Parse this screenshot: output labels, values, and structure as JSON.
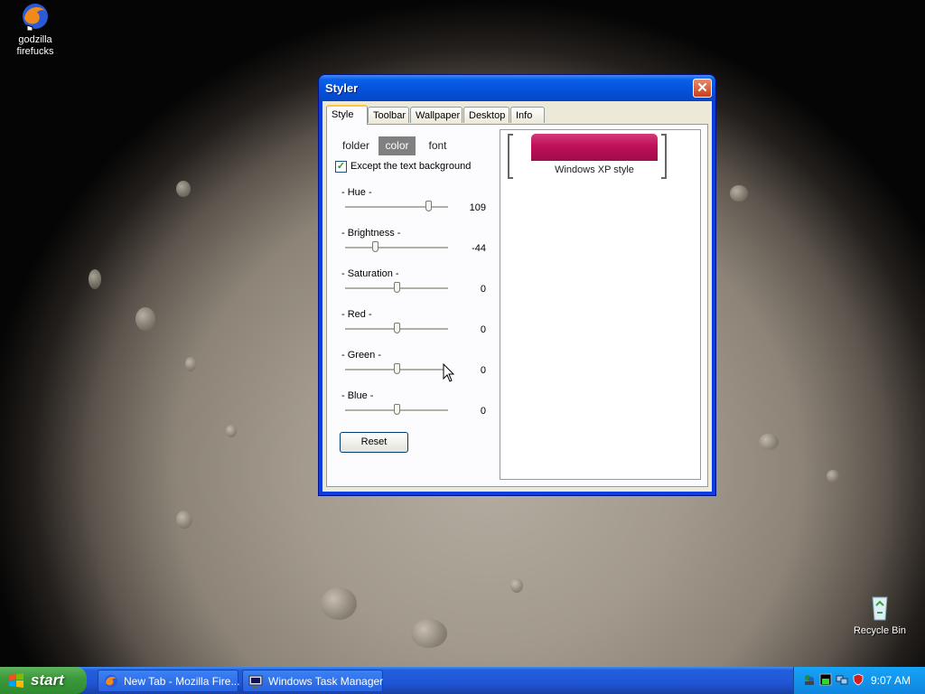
{
  "desktop": {
    "icons": [
      {
        "label": "godzilla firefucks",
        "icon": "firefox-icon"
      },
      {
        "label": "Recycle Bin",
        "icon": "recycle-bin-icon"
      }
    ]
  },
  "window": {
    "title": "Styler",
    "close_label": "✕",
    "tabs": [
      "Style",
      "Toolbar",
      "Wallpaper",
      "Desktop",
      "Info"
    ],
    "active_tab": "Style",
    "subtabs": [
      "folder",
      "color",
      "font"
    ],
    "active_subtab": "color",
    "checkbox": {
      "label": "Except the text background",
      "checked": true
    },
    "sliders": [
      {
        "label": "- Hue -",
        "value": "109",
        "position": 0.81
      },
      {
        "label": "- Brightness -",
        "value": "-44",
        "position": 0.29
      },
      {
        "label": "- Saturation -",
        "value": "0",
        "position": 0.5
      },
      {
        "label": "- Red -",
        "value": "0",
        "position": 0.5
      },
      {
        "label": "- Green -",
        "value": "0",
        "position": 0.5
      },
      {
        "label": "- Blue -",
        "value": "0",
        "position": 0.5
      }
    ],
    "reset_label": "Reset",
    "preview": {
      "label": "Windows XP style",
      "swatch_color": "#c0105a"
    }
  },
  "taskbar": {
    "start_label": "start",
    "buttons": [
      {
        "label": "New Tab - Mozilla Fire...",
        "icon": "firefox-icon"
      },
      {
        "label": "Windows Task Manager",
        "icon": "task-manager-icon"
      }
    ],
    "tray_icons": [
      "messenger-icon",
      "cpu-meter-icon",
      "network-icon",
      "security-shield-icon"
    ],
    "clock": "9:07 AM"
  }
}
